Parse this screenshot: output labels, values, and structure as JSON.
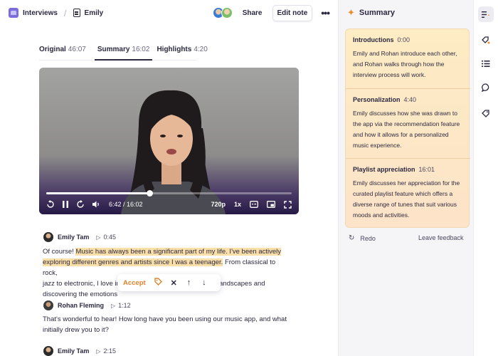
{
  "breadcrumb": {
    "root": "Interviews",
    "doc": "Emily"
  },
  "header": {
    "share": "Share",
    "edit": "Edit note",
    "more": "•••"
  },
  "tabs": [
    {
      "label": "Original",
      "duration": "46:07"
    },
    {
      "label": "Summary",
      "duration": "16:02"
    },
    {
      "label": "Highlights",
      "duration": "4:20"
    }
  ],
  "video": {
    "time": "6:42 / 16:02",
    "quality": "720p",
    "speed": "1x",
    "progress": 0.42
  },
  "transcript": [
    {
      "speaker": "Emily Tam",
      "time": "0:45"
    },
    {
      "speaker": "Rohan Fleming",
      "time": "1:12"
    },
    {
      "speaker": "Emily Tam",
      "time": "2:15"
    }
  ],
  "para1": {
    "pre": "Of course! ",
    "hl1": "Music has always been a significant part of my life. I've been actively",
    "hl2": "exploring different genres and artists since I was a teenager.",
    "post": " From classical to rock,",
    "line3": "jazz to electronic, I love immersing myself in various sonic landscapes and",
    "line4": "discovering the emotions"
  },
  "para2": {
    "line1": "That's wonderful to hear! How long have you been using our music app, and what",
    "line2": "initially drew you to it?"
  },
  "popup": {
    "accept": "Accept"
  },
  "summary": {
    "title": "Summary",
    "sections": [
      {
        "title": "Introductions",
        "time": "0:00",
        "body": "Emily and Rohan introduce each other, and Rohan walks through how the interview process will work."
      },
      {
        "title": "Personalization",
        "time": "4:40",
        "body": "Emily discusses how she was drawn to the app via the recommendation feature and how it allows for a personalized music experience."
      },
      {
        "title": "Playlist appreciation",
        "time": "16:01",
        "body": "Emily discusses her appreciation for the curated playlist feature which offers a diverse range of tunes that suit various moods and activities."
      }
    ],
    "redo": "Redo",
    "feedback": "Leave feedback"
  },
  "colors": {
    "accent": "#f08a24",
    "highlight": "#fbdfa8",
    "card": "#fdecc4",
    "video_bottom": "#2a1d4a"
  }
}
